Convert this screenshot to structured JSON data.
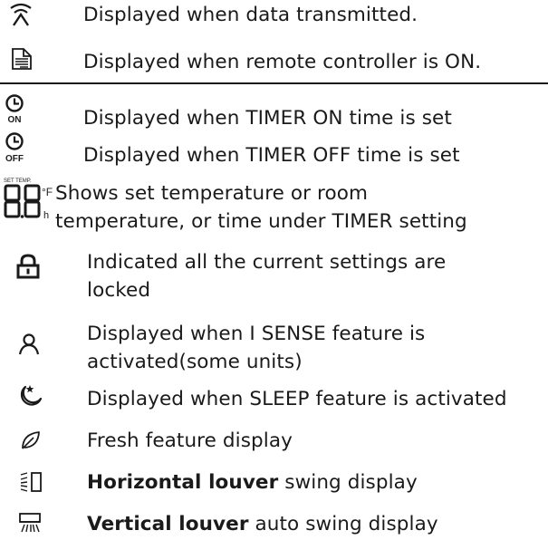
{
  "rows": [
    {
      "icon": "transmit-icon",
      "text": "Displayed when data transmitted."
    },
    {
      "icon": "remote-on-icon",
      "text": "Displayed when remote controller is ON."
    },
    {
      "icon": "timer-on-icon",
      "icon_label": "ON",
      "text": "Displayed when TIMER ON time is set"
    },
    {
      "icon": "timer-off-icon",
      "icon_label": "OFF",
      "text": "Displayed when TIMER OFF time is set"
    },
    {
      "icon": "temperature-digits-icon",
      "icon_label_top": "SET TEMP.",
      "icon_unit_f": "°F",
      "icon_unit_h": "h",
      "text_line1": "Shows set temperature or room",
      "text_line2": "temperature, or time under TIMER setting"
    },
    {
      "icon": "lock-icon",
      "text_line1": "Indicated all the current settings are",
      "text_line2": "locked"
    },
    {
      "icon": "i-sense-person-icon",
      "text_line1": "Displayed when I SENSE feature is",
      "text_line2": "activated(some units)"
    },
    {
      "icon": "sleep-icon",
      "text": "Displayed when SLEEP feature is activated"
    },
    {
      "icon": "fresh-leaf-icon",
      "text": "Fresh feature display"
    },
    {
      "icon": "horizontal-louver-icon",
      "bold": "Horizontal louver",
      "text": " swing display"
    },
    {
      "icon": "vertical-louver-icon",
      "bold": "Vertical louver",
      "text": " auto swing display"
    }
  ]
}
